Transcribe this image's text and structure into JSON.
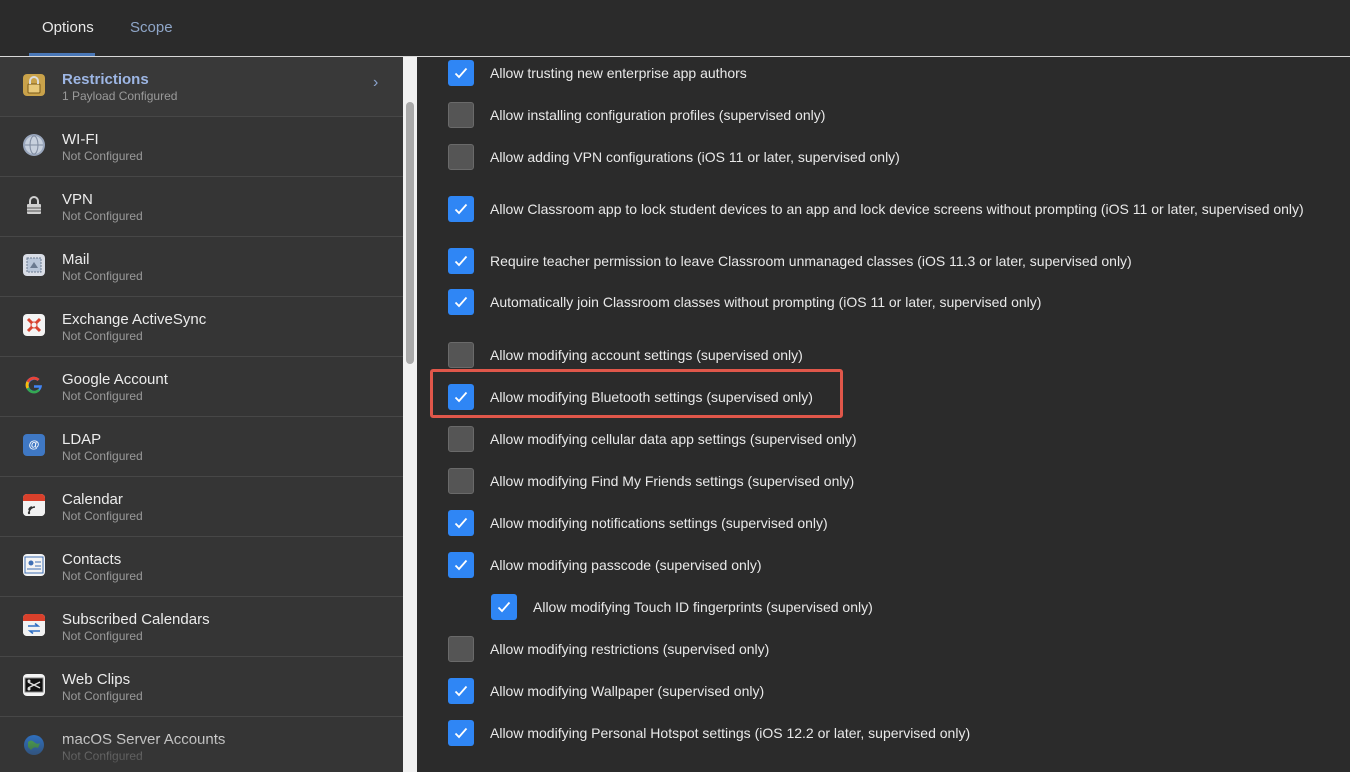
{
  "tabs": {
    "options": "Options",
    "scope": "Scope"
  },
  "sidebar": {
    "items": [
      {
        "title": "Restrictions",
        "subtitle": "1 Payload Configured",
        "icon": "lock-icon"
      },
      {
        "title": "WI-FI",
        "subtitle": "Not Configured",
        "icon": "wifi-globe-icon"
      },
      {
        "title": "VPN",
        "subtitle": "Not Configured",
        "icon": "vpn-lock-icon"
      },
      {
        "title": "Mail",
        "subtitle": "Not Configured",
        "icon": "mail-stamp-icon"
      },
      {
        "title": "Exchange ActiveSync",
        "subtitle": "Not Configured",
        "icon": "exchange-icon"
      },
      {
        "title": "Google Account",
        "subtitle": "Not Configured",
        "icon": "google-icon"
      },
      {
        "title": "LDAP",
        "subtitle": "Not Configured",
        "icon": "ldap-book-icon"
      },
      {
        "title": "Calendar",
        "subtitle": "Not Configured",
        "icon": "calendar-icon"
      },
      {
        "title": "Contacts",
        "subtitle": "Not Configured",
        "icon": "contacts-icon"
      },
      {
        "title": "Subscribed Calendars",
        "subtitle": "Not Configured",
        "icon": "subscribed-calendar-icon"
      },
      {
        "title": "Web Clips",
        "subtitle": "Not Configured",
        "icon": "web-clip-icon"
      },
      {
        "title": "macOS Server Accounts",
        "subtitle": "Not Configured",
        "icon": "server-globe-icon"
      }
    ]
  },
  "options": [
    {
      "label": "Allow trusting new enterprise app authors",
      "checked": true
    },
    {
      "label": "Allow installing configuration profiles (supervised only)",
      "checked": false
    },
    {
      "label": "Allow adding VPN configurations (iOS 11 or later, supervised only)",
      "checked": false
    },
    {
      "label": "Allow Classroom app to lock student devices to an app and lock device screens without prompting (iOS 11 or later, supervised only)",
      "checked": true
    },
    {
      "label": "Require teacher permission to leave Classroom unmanaged classes (iOS 11.3 or later, supervised only)",
      "checked": true
    },
    {
      "label": "Automatically join Classroom classes without prompting (iOS 11 or later, supervised only)",
      "checked": true
    },
    {
      "label": "Allow modifying account settings (supervised only)",
      "checked": false
    },
    {
      "label": "Allow modifying Bluetooth settings (supervised only)",
      "checked": true
    },
    {
      "label": "Allow modifying cellular data app settings (supervised only)",
      "checked": false
    },
    {
      "label": "Allow modifying Find My Friends settings (supervised only)",
      "checked": false
    },
    {
      "label": "Allow modifying notifications settings (supervised only)",
      "checked": true
    },
    {
      "label": "Allow modifying passcode (supervised only)",
      "checked": true
    },
    {
      "label": "Allow modifying Touch ID fingerprints (supervised only)",
      "checked": true
    },
    {
      "label": "Allow modifying restrictions (supervised only)",
      "checked": false
    },
    {
      "label": "Allow modifying Wallpaper (supervised only)",
      "checked": true
    },
    {
      "label": "Allow modifying Personal Hotspot settings (iOS 12.2 or later, supervised only)",
      "checked": true
    }
  ],
  "colors": {
    "accent": "#2f86f5",
    "highlight": "#e0574a",
    "active_item": "#9db6e4"
  }
}
